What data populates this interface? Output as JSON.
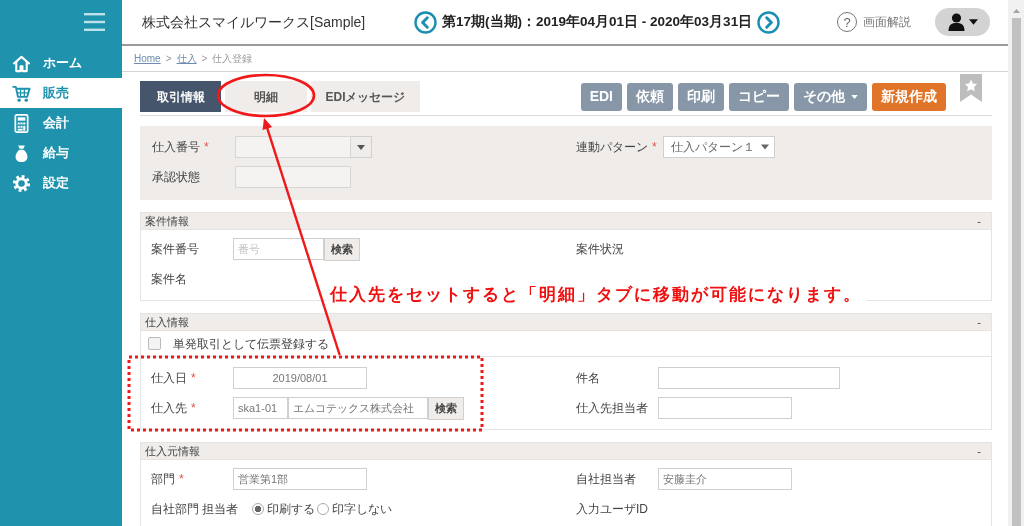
{
  "sidebar": {
    "items": [
      {
        "label": "ホーム",
        "kind": "home",
        "selected": false
      },
      {
        "label": "販売",
        "kind": "cart",
        "selected": true
      },
      {
        "label": "会計",
        "kind": "calculator",
        "selected": false
      },
      {
        "label": "給与",
        "kind": "moneybag",
        "selected": false
      },
      {
        "label": "設定",
        "kind": "gear",
        "selected": false
      }
    ]
  },
  "header": {
    "company": "株式会社スマイルワークス[Sample]",
    "period": "第17期(当期)：2019年04月01日 - 2020年03月31日",
    "help_icon": "?",
    "help": "画面解説"
  },
  "breadcrumb": {
    "separator": ">",
    "items": [
      {
        "label": "Home",
        "link": true
      },
      {
        "label": "仕入",
        "link": true
      },
      {
        "label": "仕入登録",
        "link": false
      }
    ]
  },
  "tabs": [
    {
      "label": "取引情報",
      "selected": true,
      "circled": false
    },
    {
      "label": "明細",
      "selected": false,
      "circled": true
    },
    {
      "label": "EDIメッセージ",
      "selected": false,
      "circled": false
    }
  ],
  "actions": [
    {
      "label": "EDI",
      "kind": "plain",
      "disabled": true
    },
    {
      "label": "依頼",
      "kind": "plain",
      "disabled": true
    },
    {
      "label": "印刷",
      "kind": "plain",
      "disabled": true
    },
    {
      "label": "コピー",
      "kind": "plain",
      "disabled": true
    },
    {
      "label": "その他",
      "kind": "dropdown",
      "disabled": true
    },
    {
      "label": "新規作成",
      "kind": "primary",
      "disabled": false
    }
  ],
  "summary": {
    "rows": [
      {
        "left": {
          "label": "仕入番号",
          "required_mark": "*",
          "kind": "combo"
        },
        "right": {
          "label": "連動パターン",
          "required_mark": "*",
          "kind": "select",
          "value": "仕入パターン１"
        }
      },
      {
        "left": {
          "label": "承認状態",
          "kind": "text"
        }
      }
    ]
  },
  "sections": [
    {
      "title": "案件情報",
      "toggle": "-",
      "rows": [
        {
          "left": {
            "label": "案件番号",
            "kind": "search",
            "placeholder": "番号",
            "button": "検索"
          },
          "right": {
            "label": "案件状況",
            "kind": "label"
          }
        },
        {
          "left": {
            "label": "案件名",
            "kind": "label"
          }
        }
      ]
    },
    {
      "title": "仕入情報",
      "toggle": "-",
      "checkbox": {
        "label": "単発取引として伝票登録する",
        "checked": false
      },
      "rows": [
        {
          "highlighted": true,
          "left": {
            "label": "仕入日",
            "required_mark": "*",
            "kind": "date",
            "value": "2019/08/01"
          },
          "right": {
            "label": "件名",
            "kind": "text"
          }
        },
        {
          "highlighted": true,
          "left": {
            "label": "仕入先",
            "required_mark": "*",
            "kind": "code_search",
            "code": "ska1-01",
            "value": "エムコテックス株式会社",
            "button": "検索"
          },
          "right": {
            "label": "仕入先担当者",
            "kind": "text"
          }
        }
      ]
    },
    {
      "title": "仕入元情報",
      "toggle": "-",
      "rows": [
        {
          "left": {
            "label": "部門",
            "required_mark": "*",
            "kind": "text",
            "value": "営業第1部"
          },
          "right": {
            "label": "自社担当者",
            "kind": "text",
            "value": "安藤圭介"
          }
        },
        {
          "left": {
            "label": "自社部門 担当者",
            "kind": "radio",
            "options": [
              {
                "label": "印刷する",
                "selected": true
              },
              {
                "label": "印字しない",
                "selected": false
              }
            ]
          },
          "right": {
            "label": "入力ユーザID",
            "kind": "label"
          }
        }
      ]
    }
  ],
  "annotation": {
    "text": "仕入先をセットすると「明細」タブに移動が可能になります。"
  }
}
